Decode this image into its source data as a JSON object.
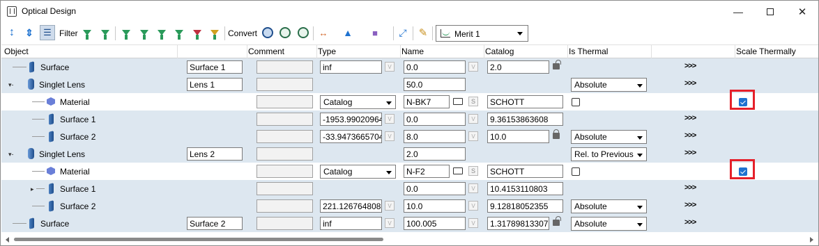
{
  "window": {
    "title": "Optical Design"
  },
  "toolbar": {
    "filter_label": "Filter",
    "convert_label": "Convert",
    "merit_value": "Merit 1"
  },
  "columns": [
    "Object",
    "Comment",
    "Type",
    "Name",
    "Catalog",
    "Is Thermal",
    "Scale Thermally"
  ],
  "rows": [
    {
      "label": "Surface",
      "kind": "surface",
      "object": "Surface 1",
      "type": "inf",
      "name": "0.0",
      "catalog": "2.0",
      "is_thermal": "",
      "more": ">>>"
    },
    {
      "label": "Singlet Lens",
      "kind": "lens",
      "object": "Lens 1",
      "type": "",
      "name": "50.0",
      "catalog": "",
      "is_thermal": "Absolute",
      "more": ">>>"
    },
    {
      "label": "Material",
      "kind": "material",
      "object": "",
      "type": "Catalog",
      "name": "N-BK7",
      "catalog": "SCHOTT",
      "scale_thermally": true
    },
    {
      "label": "Surface 1",
      "kind": "surface",
      "object": "",
      "type": "-1953.99020964",
      "name": "0.0",
      "catalog": "9.36153863608",
      "is_thermal": "",
      "more": ">>>"
    },
    {
      "label": "Surface 2",
      "kind": "surface",
      "object": "",
      "type": "-33.9473665704",
      "name": "8.0",
      "catalog": "10.0",
      "is_thermal": "Absolute",
      "more": ">>>"
    },
    {
      "label": "Singlet Lens",
      "kind": "lens",
      "object": "Lens 2",
      "type": "",
      "name": "2.0",
      "catalog": "",
      "is_thermal": "Rel. to Previous",
      "more": ">>>"
    },
    {
      "label": "Material",
      "kind": "material",
      "object": "",
      "type": "Catalog",
      "name": "N-F2",
      "catalog": "SCHOTT",
      "scale_thermally": true
    },
    {
      "label": "Surface 1",
      "kind": "surface",
      "object": "",
      "type": "",
      "name": "0.0",
      "catalog": "10.4153110803",
      "is_thermal": "",
      "more": ">>>"
    },
    {
      "label": "Surface 2",
      "kind": "surface",
      "object": "",
      "type": "221.126764808",
      "name": "10.0",
      "catalog": "9.12818052355",
      "is_thermal": "Absolute",
      "more": ">>>"
    },
    {
      "label": "Surface",
      "kind": "surface",
      "object": "Surface 2",
      "type": "inf",
      "name": "100.005",
      "catalog": "1.31789813307",
      "is_thermal": "Absolute",
      "more": ">>>"
    }
  ]
}
